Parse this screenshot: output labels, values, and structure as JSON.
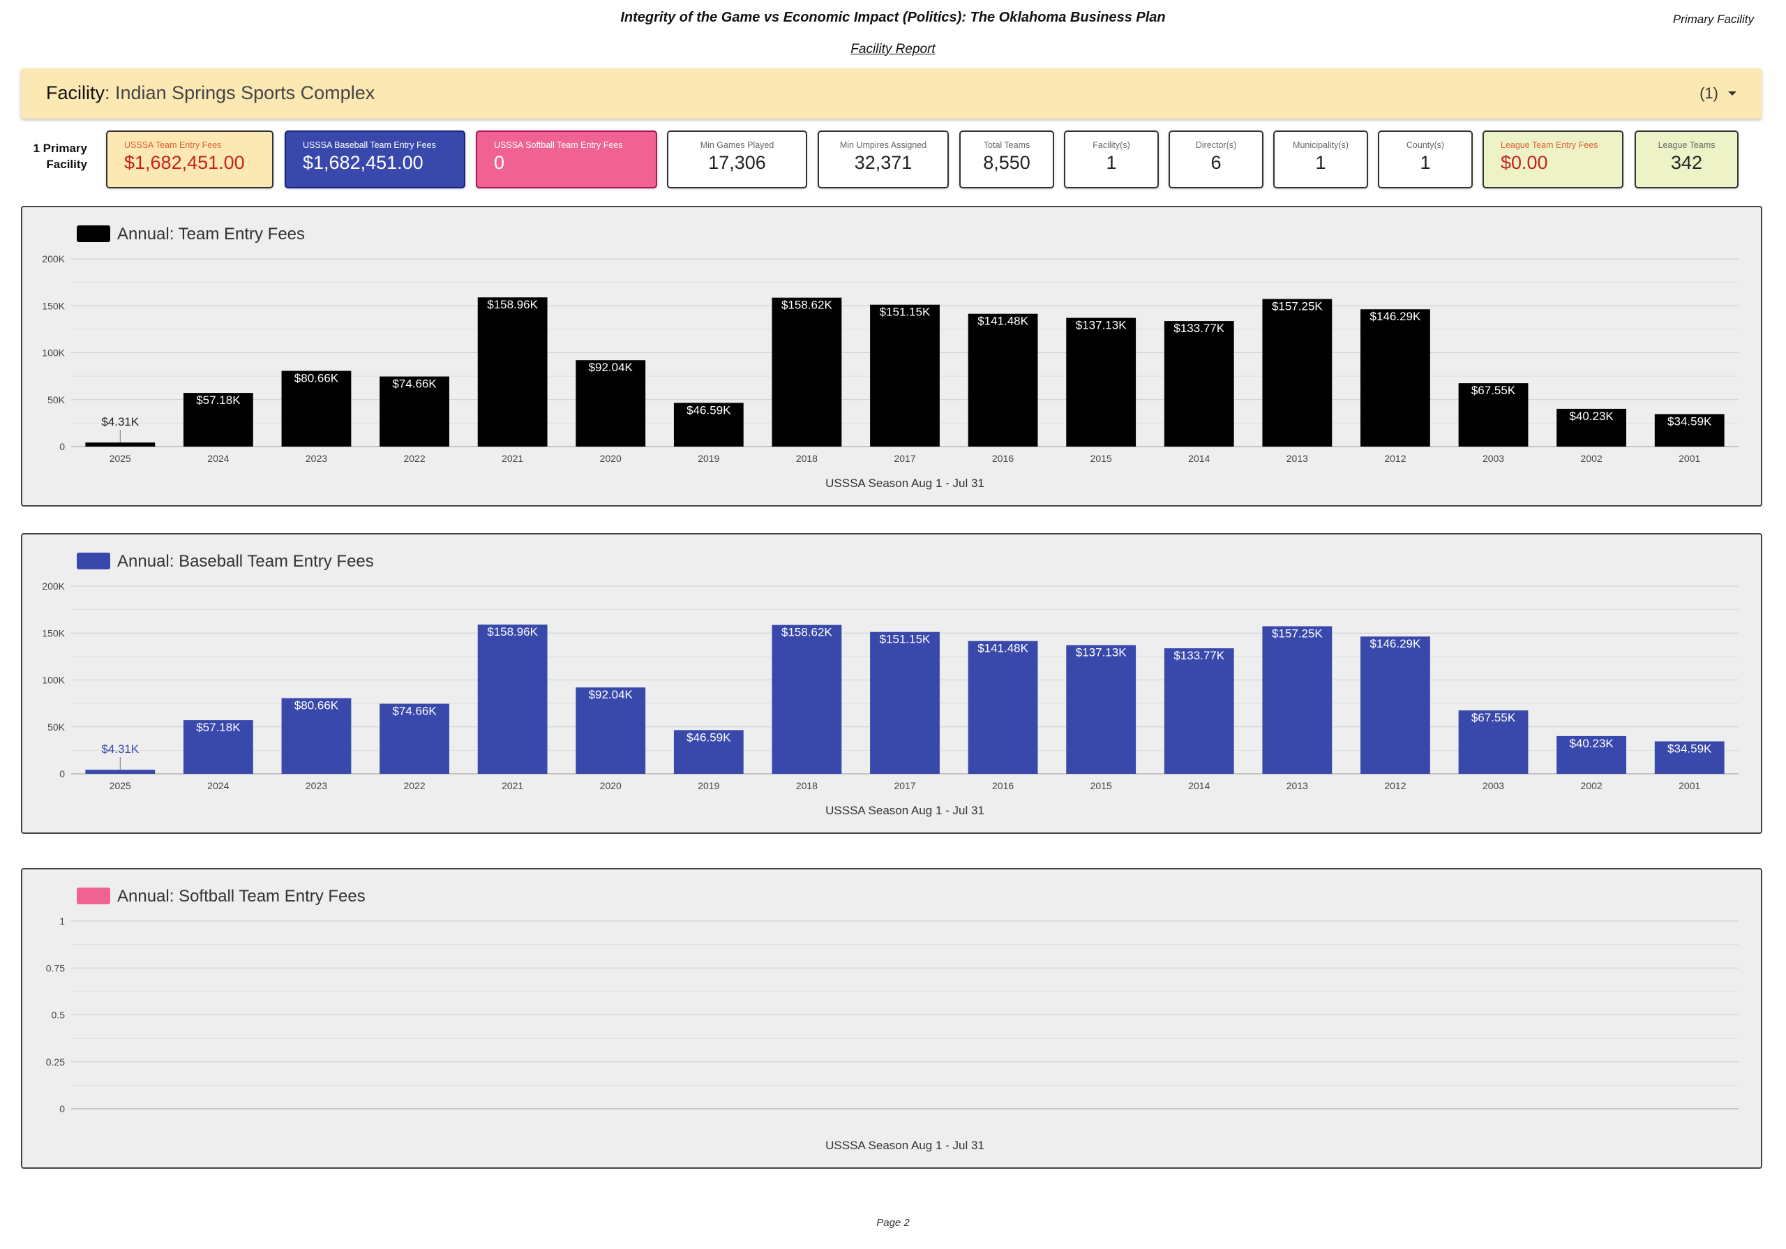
{
  "header": {
    "title": "Integrity of the Game vs Economic Impact (Politics): The Oklahoma Business Plan",
    "right_label": "Primary Facility",
    "subtitle": "Facility Report"
  },
  "facility": {
    "key": "Facility",
    "name": ": Indian Springs Sports Complex",
    "count": "(1)"
  },
  "primary_label": "1 Primary Facility",
  "kpis": [
    {
      "label": "USSSA Team Entry Fees",
      "value": "$1,682,451.00",
      "bg": "#fce8b2",
      "label_color": "#e06030",
      "value_color": "#c5221f"
    },
    {
      "label": "USSSA Baseball Team Entry Fees",
      "value": "$1,682,451.00",
      "bg": "#3949ab",
      "label_color": "#ffffff",
      "value_color": "#ffffff"
    },
    {
      "label": "USSSA Softball Team Entry Fees",
      "value": "0",
      "bg": "#f06292",
      "label_color": "#ffffff",
      "value_color": "#ffffff"
    },
    {
      "label": "Min Games Played",
      "value": "17,306",
      "bg": "#ffffff",
      "label_color": "#666666",
      "value_color": "#222222"
    },
    {
      "label": "Min Umpires Assigned",
      "value": "32,371",
      "bg": "#ffffff",
      "label_color": "#666666",
      "value_color": "#222222"
    },
    {
      "label": "Total Teams",
      "value": "8,550",
      "bg": "#ffffff",
      "label_color": "#666666",
      "value_color": "#222222"
    },
    {
      "label": "Facility(s)",
      "value": "1",
      "bg": "#ffffff",
      "label_color": "#666666",
      "value_color": "#222222"
    },
    {
      "label": "Director(s)",
      "value": "6",
      "bg": "#ffffff",
      "label_color": "#666666",
      "value_color": "#222222"
    },
    {
      "label": "Municipality(s)",
      "value": "1",
      "bg": "#ffffff",
      "label_color": "#666666",
      "value_color": "#222222"
    },
    {
      "label": "County(s)",
      "value": "1",
      "bg": "#ffffff",
      "label_color": "#666666",
      "value_color": "#222222"
    },
    {
      "label": "League Team Entry Fees",
      "value": "$0.00",
      "bg": "#eef3c7",
      "label_color": "#e06030",
      "value_color": "#c5221f"
    },
    {
      "label": "League Teams",
      "value": "342",
      "bg": "#eef3c7",
      "label_color": "#666666",
      "value_color": "#222222"
    }
  ],
  "chart_data": [
    {
      "type": "bar",
      "title": "Annual: Team Entry Fees",
      "xlabel": "USSSA Season Aug 1 - Jul 31",
      "ylabel": "",
      "color": "#000000",
      "label_color_outside": "#222222",
      "categories": [
        "2025",
        "2024",
        "2023",
        "2022",
        "2021",
        "2020",
        "2019",
        "2018",
        "2017",
        "2016",
        "2015",
        "2014",
        "2013",
        "2012",
        "2003",
        "2002",
        "2001"
      ],
      "values": [
        4310,
        57180,
        80660,
        74660,
        158960,
        92040,
        46590,
        158620,
        151150,
        141480,
        137130,
        133770,
        157250,
        146290,
        67550,
        40230,
        34590
      ],
      "data_labels": [
        "$4.31K",
        "$57.18K",
        "$80.66K",
        "$74.66K",
        "$158.96K",
        "$92.04K",
        "$46.59K",
        "$158.62K",
        "$151.15K",
        "$141.48K",
        "$137.13K",
        "$133.77K",
        "$157.25K",
        "$146.29K",
        "$67.55K",
        "$40.23K",
        "$34.59K"
      ],
      "yticks": [
        0,
        50000,
        100000,
        150000,
        200000
      ],
      "ytick_labels": [
        "0",
        "50K",
        "100K",
        "150K",
        "200K"
      ],
      "ylim": [
        0,
        200000
      ],
      "grid": true,
      "legend": "top-left"
    },
    {
      "type": "bar",
      "title": "Annual: Baseball Team Entry Fees",
      "xlabel": "USSSA Season Aug 1 - Jul 31",
      "ylabel": "",
      "color": "#3949ab",
      "label_color_outside": "#3949ab",
      "categories": [
        "2025",
        "2024",
        "2023",
        "2022",
        "2021",
        "2020",
        "2019",
        "2018",
        "2017",
        "2016",
        "2015",
        "2014",
        "2013",
        "2012",
        "2003",
        "2002",
        "2001"
      ],
      "values": [
        4310,
        57180,
        80660,
        74660,
        158960,
        92040,
        46590,
        158620,
        151150,
        141480,
        137130,
        133770,
        157250,
        146290,
        67550,
        40230,
        34590
      ],
      "data_labels": [
        "$4.31K",
        "$57.18K",
        "$80.66K",
        "$74.66K",
        "$158.96K",
        "$92.04K",
        "$46.59K",
        "$158.62K",
        "$151.15K",
        "$141.48K",
        "$137.13K",
        "$133.77K",
        "$157.25K",
        "$146.29K",
        "$67.55K",
        "$40.23K",
        "$34.59K"
      ],
      "yticks": [
        0,
        50000,
        100000,
        150000,
        200000
      ],
      "ytick_labels": [
        "0",
        "50K",
        "100K",
        "150K",
        "200K"
      ],
      "ylim": [
        0,
        200000
      ],
      "grid": true,
      "legend": "top-left"
    },
    {
      "type": "bar",
      "title": "Annual: Softball Team Entry Fees",
      "xlabel": "USSSA Season Aug 1 - Jul 31",
      "ylabel": "",
      "color": "#f06292",
      "label_color_outside": "#f06292",
      "categories": [],
      "values": [],
      "data_labels": [],
      "yticks": [
        0,
        0.25,
        0.5,
        0.75,
        1
      ],
      "ytick_labels": [
        "0",
        "0.25",
        "0.5",
        "0.75",
        "1"
      ],
      "ylim": [
        0,
        1
      ],
      "grid": true,
      "legend": "top-left"
    }
  ],
  "footer": {
    "page": "Page 2"
  }
}
